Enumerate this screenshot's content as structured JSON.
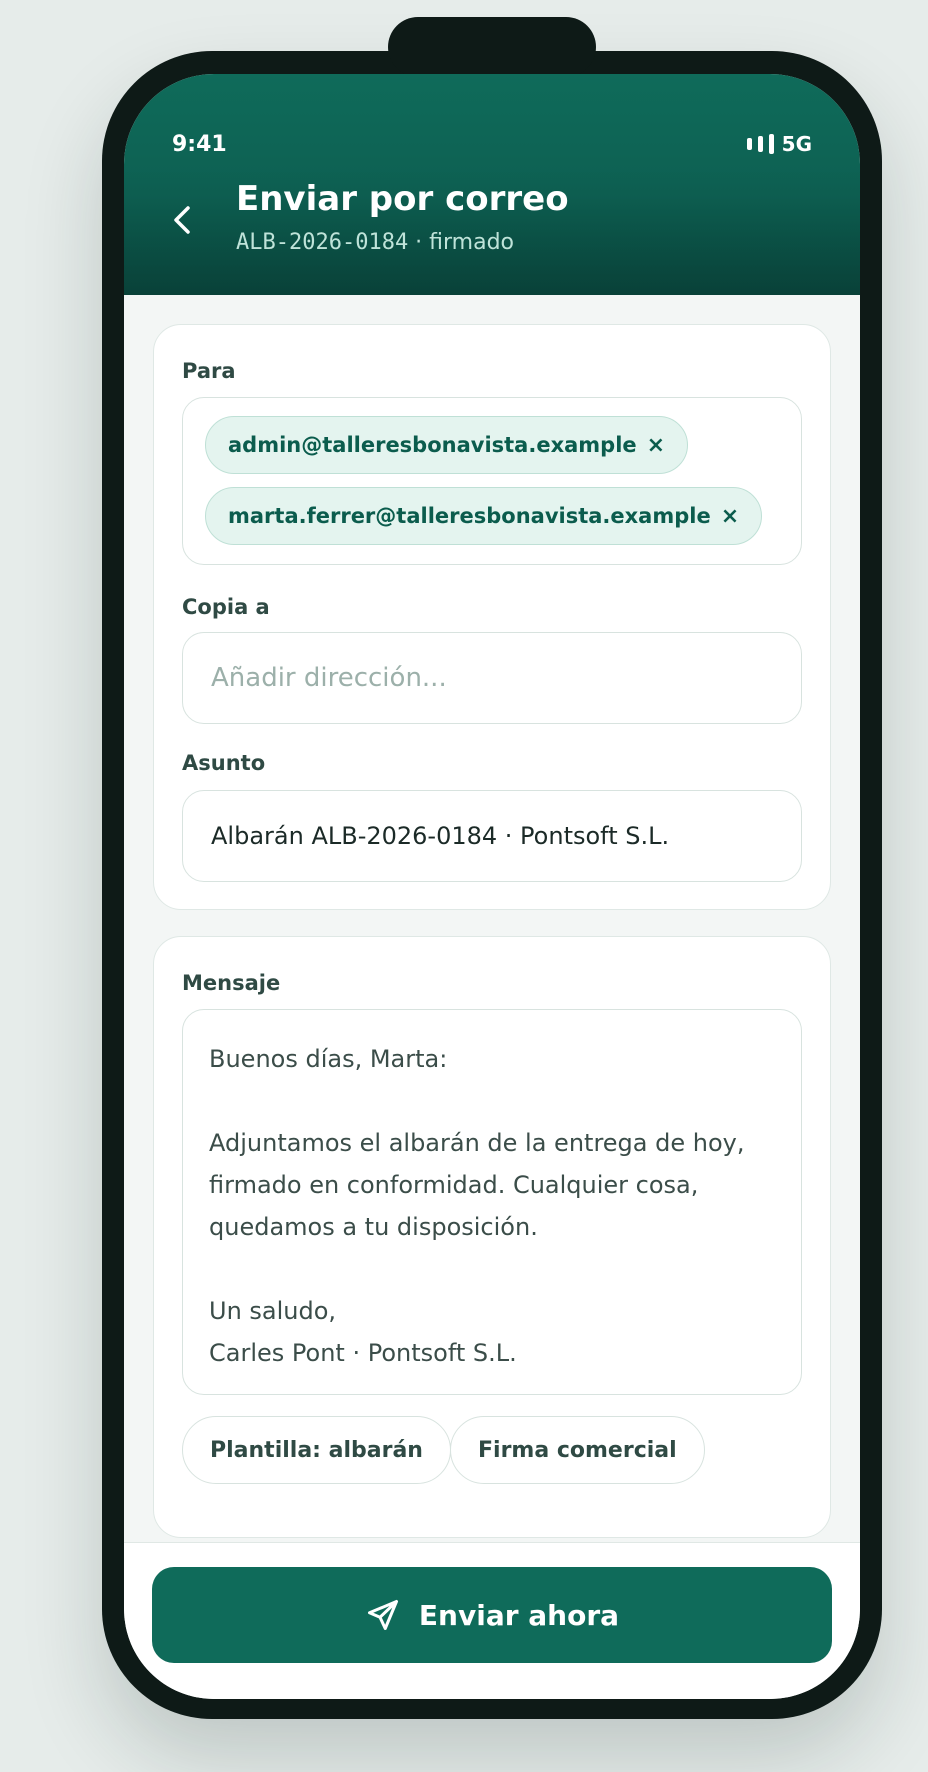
{
  "status_bar": {
    "time": "9:41",
    "network": "5G"
  },
  "header": {
    "title": "Enviar por correo",
    "doc_code": "ALB-2026-0184",
    "doc_status": " · firmado"
  },
  "form": {
    "to_label": "Para",
    "to_recipients": [
      "admin@talleresbonavista.example",
      "marta.ferrer@talleresbonavista.example"
    ],
    "remove_symbol": "×",
    "cc_label": "Copia a",
    "cc_placeholder": "Añadir dirección...",
    "subject_label": "Asunto",
    "subject_value": "Albarán ALB-2026-0184 · Pontsoft S.L."
  },
  "message": {
    "label": "Mensaje",
    "lines": [
      "Buenos días, Marta:",
      "",
      "Adjuntamos el albarán de la entrega de hoy,",
      "firmado en conformidad. Cualquier cosa,",
      "quedamos a tu disposición.",
      "",
      "Un saludo,",
      "Carles Pont · Pontsoft S.L."
    ],
    "template_button": "Plantilla: albarán",
    "signature_button": "Firma comercial"
  },
  "footer": {
    "send_label": "Enviar ahora"
  },
  "colors": {
    "brand": "#0f6b5a",
    "chip_bg": "#e4f4ef",
    "chip_text": "#0b5c4d"
  },
  "icons": {
    "back": "chevron-left-icon",
    "send": "paper-plane-icon"
  }
}
